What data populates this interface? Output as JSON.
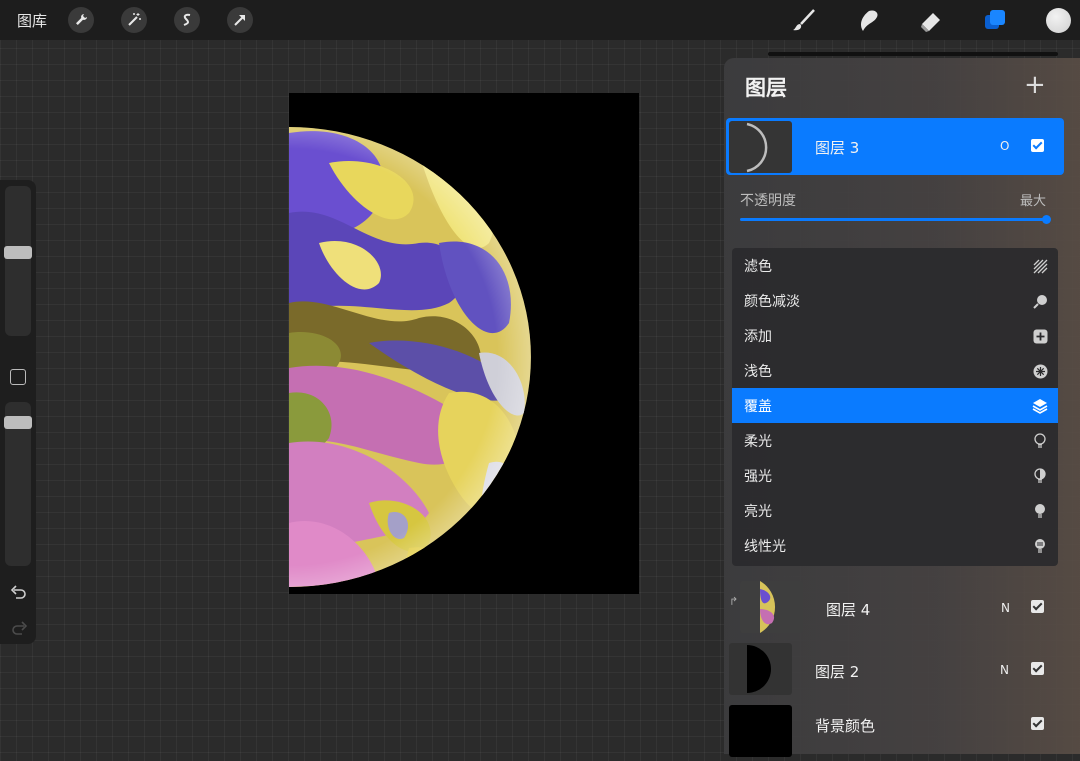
{
  "topbar": {
    "gallery_label": "图库",
    "left_tools": [
      "wrench-icon",
      "magic-wand-icon",
      "selection-icon",
      "transform-arrow-icon"
    ],
    "right_tools": [
      "brush-icon",
      "smudge-icon",
      "eraser-icon",
      "layers-icon"
    ],
    "color_swatch": "#e2e2e2"
  },
  "sidebar": {
    "size_slider_level": 0.45,
    "opacity_slider_level": 0.95
  },
  "layers_panel": {
    "title": "图层",
    "add_label": "+",
    "active_layer": {
      "name": "图层 3",
      "blend_letter": "O",
      "visible": true
    },
    "opacity": {
      "label": "不透明度",
      "value_label": "最大",
      "level": 1.0
    },
    "blend_modes": [
      {
        "label": "滤色",
        "icon": "screen-stripes-icon",
        "selected": false
      },
      {
        "label": "颜色减淡",
        "icon": "dodge-icon",
        "selected": false
      },
      {
        "label": "添加",
        "icon": "plus-square-icon",
        "selected": false
      },
      {
        "label": "浅色",
        "icon": "sparkle-icon",
        "selected": false
      },
      {
        "label": "覆盖",
        "icon": "layers-stack-icon",
        "selected": true
      },
      {
        "label": "柔光",
        "icon": "bulb-outline-icon",
        "selected": false
      },
      {
        "label": "强光",
        "icon": "bulb-half-icon",
        "selected": false
      },
      {
        "label": "亮光",
        "icon": "bulb-filled-icon",
        "selected": false
      },
      {
        "label": "线性光",
        "icon": "bulb-lines-icon",
        "selected": false
      }
    ],
    "layers": [
      {
        "name": "图层 4",
        "blend_letter": "N",
        "visible": true,
        "clipped": true
      },
      {
        "name": "图层 2",
        "blend_letter": "N",
        "visible": true
      },
      {
        "name": "背景颜色",
        "blend_letter": "",
        "visible": true
      }
    ]
  },
  "colors": {
    "accent": "#0a7bff",
    "canvas": "#000000",
    "panel": "#3c3c3e"
  }
}
